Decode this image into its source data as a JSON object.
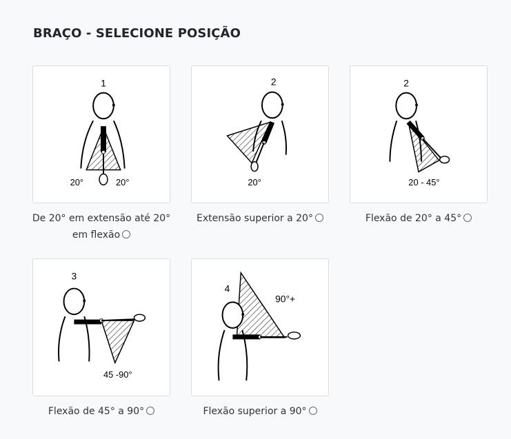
{
  "page": {
    "title": "BRAÇO - SELECIONE POSIÇÃO"
  },
  "options": [
    {
      "number": "1",
      "angle_left": "20°",
      "angle_right": "20°",
      "label": "De 20° em extensão até 20° em flexão"
    },
    {
      "number": "2",
      "angle": "20°",
      "label": "Extensão superior a 20°"
    },
    {
      "number": "2",
      "angle": "20 - 45°",
      "label": "Flexão de 20° a 45°"
    },
    {
      "number": "3",
      "angle": "45 -90°",
      "label": "Flexão de 45° a 90°"
    },
    {
      "number": "4",
      "angle": "90°+",
      "label": "Flexão superior a 90°"
    }
  ]
}
